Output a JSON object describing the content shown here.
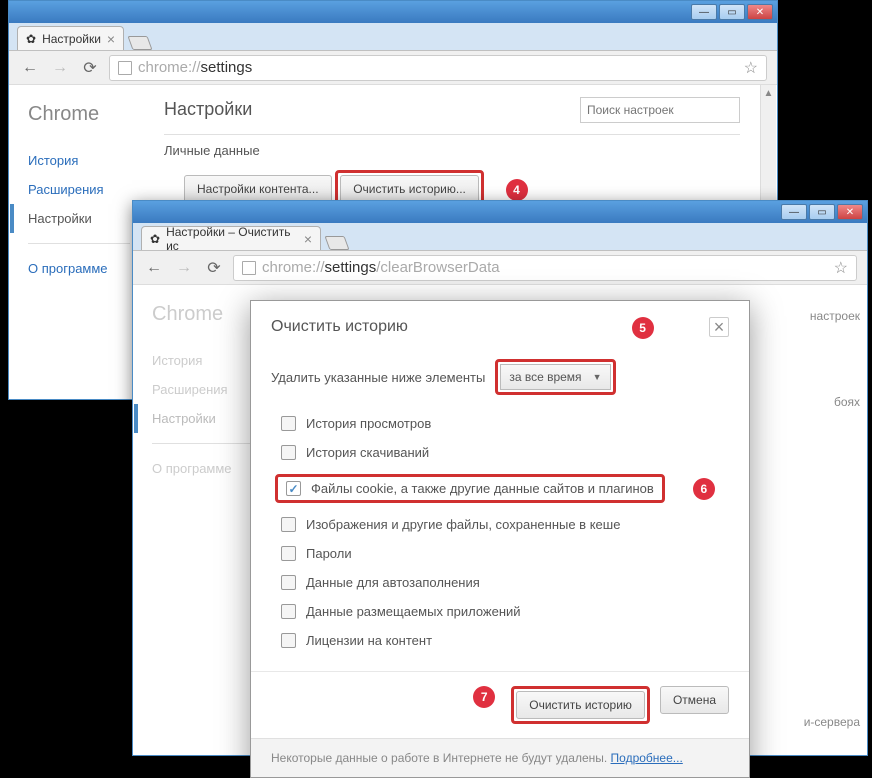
{
  "window1": {
    "tab_title": "Настройки",
    "url_prefix": "chrome://",
    "url_bold": "settings",
    "brand": "Chrome",
    "sidebar": {
      "history": "История",
      "extensions": "Расширения",
      "settings": "Настройки",
      "about": "О программе"
    },
    "page_title": "Настройки",
    "search_placeholder": "Поиск настроек",
    "section": "Личные данные",
    "btn_content": "Настройки контента...",
    "btn_clear": "Очистить историю..."
  },
  "window2": {
    "tab_title": "Настройки – Очистить ис",
    "url_prefix": "chrome://",
    "url_bold": "settings",
    "url_suffix": "/clearBrowserData",
    "brand": "Chrome",
    "sidebar": {
      "history": "История",
      "extensions": "Расширения",
      "settings": "Настройки",
      "about": "О программе"
    },
    "bg_text1": "бояx",
    "bg_text2": "и-сервера",
    "bg_btn": "Изменить настройки прокси-сервера"
  },
  "dialog": {
    "title": "Очистить историю",
    "delete_label": "Удалить указанные ниже элементы",
    "period": "за все время",
    "options": [
      {
        "label": "История просмотров",
        "checked": false
      },
      {
        "label": "История скачиваний",
        "checked": false
      },
      {
        "label": "Файлы cookie, а также другие данные сайтов и плагинов",
        "checked": true
      },
      {
        "label": "Изображения и другие файлы, сохраненные в кеше",
        "checked": false
      },
      {
        "label": "Пароли",
        "checked": false
      },
      {
        "label": "Данные для автозаполнения",
        "checked": false
      },
      {
        "label": "Данные размещаемых приложений",
        "checked": false
      },
      {
        "label": "Лицензии на контент",
        "checked": false
      }
    ],
    "btn_clear": "Очистить историю",
    "btn_cancel": "Отмена",
    "note_text": "Некоторые данные о работе в Интернете не будут удалены. ",
    "note_link": "Подробнее..."
  },
  "badges": {
    "b4": "4",
    "b5": "5",
    "b6": "6",
    "b7": "7"
  },
  "colors": {
    "accent_red": "#d03030",
    "badge_red": "#e03040",
    "link": "#2a6dbb",
    "titlebar1": "#5aa0e0",
    "titlebar2": "#3a7ac0"
  }
}
